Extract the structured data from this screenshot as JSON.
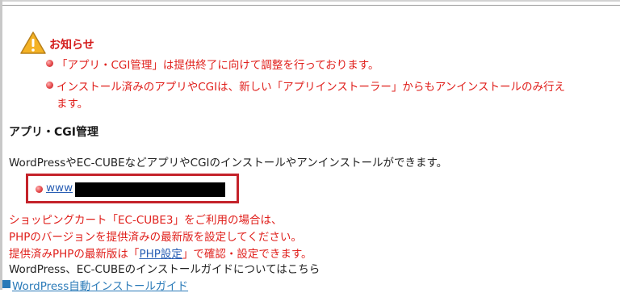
{
  "notice": {
    "title": "お知らせ",
    "items": [
      "「アプリ・CGI管理」は提供終了に向けて調整を行っております。",
      "インストール済みのアプリやCGIは、新しい「アプリインストーラー」からもアンインストールのみ行え",
      "ます。"
    ]
  },
  "section": {
    "title": "アプリ・CGI管理",
    "description": "WordPressやEC-CUBEなどアプリやCGIのインストールやアンインストールができます。",
    "app_link": "www"
  },
  "php_note": {
    "line1": "ショッピングカート「EC-CUBE3」をご利用の場合は、",
    "line2": "PHPのバージョンを提供済みの最新版を設定してください。",
    "line3_prefix": "提供済みPHPの最新版は「",
    "line3_link": "PHP設定",
    "line3_suffix": "」で確認・設定できます。"
  },
  "guide": {
    "text": "WordPress、EC-CUBEのインストールガイドについてはこちら",
    "link": "WordPress自動インストールガイド"
  },
  "colors": {
    "notice_red": "#e0201c",
    "link_blue": "#2a5fb4",
    "highlight_border": "#c4222a"
  }
}
